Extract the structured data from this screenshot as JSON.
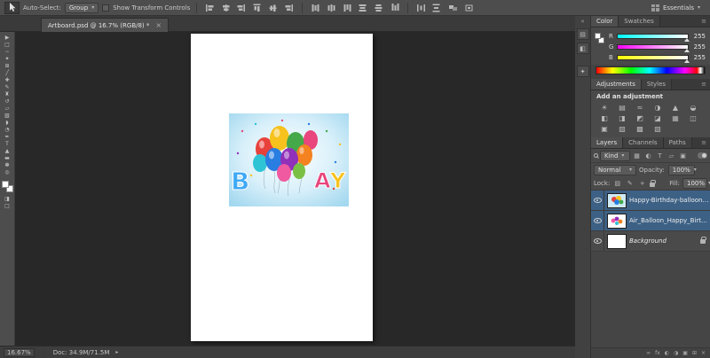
{
  "colors": {
    "selection_highlight": "#3d6185",
    "canvas_background": "#282828",
    "artboard_white": "#ffffff"
  },
  "options_bar": {
    "auto_select_label": "Auto-Select:",
    "auto_select_value": "Group",
    "show_transform_label": "Show Transform Controls",
    "workspace_label": "Essentials"
  },
  "document_tab": {
    "title": "Artboard.psd @ 16.7% (RGB/8) *",
    "close_glyph": "×"
  },
  "toolbar": {
    "tools": [
      {
        "name": "move-tool",
        "glyph": "▶"
      },
      {
        "name": "rectangular-marquee-tool",
        "glyph": "□"
      },
      {
        "name": "lasso-tool",
        "glyph": "∽"
      },
      {
        "name": "quick-selection-tool",
        "glyph": "✦"
      },
      {
        "name": "crop-tool",
        "glyph": "⊞"
      },
      {
        "name": "eyedropper-tool",
        "glyph": "╱"
      },
      {
        "name": "spot-healing-brush-tool",
        "glyph": "✚"
      },
      {
        "name": "brush-tool",
        "glyph": "✎"
      },
      {
        "name": "clone-stamp-tool",
        "glyph": "♜"
      },
      {
        "name": "history-brush-tool",
        "glyph": "↺"
      },
      {
        "name": "eraser-tool",
        "glyph": "▱"
      },
      {
        "name": "gradient-tool",
        "glyph": "▧"
      },
      {
        "name": "blur-tool",
        "glyph": "◗"
      },
      {
        "name": "dodge-tool",
        "glyph": "◔"
      },
      {
        "name": "pen-tool",
        "glyph": "✒"
      },
      {
        "name": "horizontal-type-tool",
        "glyph": "T"
      },
      {
        "name": "path-selection-tool",
        "glyph": "▲"
      },
      {
        "name": "rectangle-tool",
        "glyph": "▬"
      },
      {
        "name": "hand-tool",
        "glyph": "✽"
      },
      {
        "name": "zoom-tool",
        "glyph": "◎"
      }
    ],
    "extras": [
      {
        "name": "quick-mask-button",
        "glyph": "◨"
      },
      {
        "name": "screen-mode-button",
        "glyph": "□"
      }
    ]
  },
  "color_panel": {
    "tabs": [
      "Color",
      "Swatches"
    ],
    "menu_glyph": "≡",
    "channels": [
      {
        "label": "R",
        "value": "255",
        "track_from": "#00ffff",
        "track_to": "#ffffff"
      },
      {
        "label": "G",
        "value": "255",
        "track_from": "#ff00ff",
        "track_to": "#ffffff"
      },
      {
        "label": "B",
        "value": "255",
        "track_from": "#ffff00",
        "track_to": "#ffffff"
      }
    ]
  },
  "adjustments_panel": {
    "tabs": [
      "Adjustments",
      "Styles"
    ],
    "title": "Add an adjustment",
    "icons": [
      {
        "name": "brightness-contrast-icon",
        "glyph": "☀"
      },
      {
        "name": "levels-icon",
        "glyph": "▤"
      },
      {
        "name": "curves-icon",
        "glyph": "≈"
      },
      {
        "name": "exposure-icon",
        "glyph": "◑"
      },
      {
        "name": "vibrance-icon",
        "glyph": "▲"
      },
      {
        "name": "hue-saturation-icon",
        "glyph": "◒"
      },
      {
        "name": "color-balance-icon",
        "glyph": "◧"
      },
      {
        "name": "black-white-icon",
        "glyph": "◨"
      },
      {
        "name": "photo-filter-icon",
        "glyph": "◩"
      },
      {
        "name": "channel-mixer-icon",
        "glyph": "◪"
      },
      {
        "name": "color-lookup-icon",
        "glyph": "▦"
      },
      {
        "name": "invert-icon",
        "glyph": "◫"
      },
      {
        "name": "posterize-icon",
        "glyph": "▣"
      },
      {
        "name": "threshold-icon",
        "glyph": "▨"
      },
      {
        "name": "selective-color-icon",
        "glyph": "▩"
      },
      {
        "name": "gradient-map-icon",
        "glyph": "▧"
      }
    ]
  },
  "layers_panel": {
    "tabs": [
      "Layers",
      "Channels",
      "Paths"
    ],
    "kind_value": "Kind",
    "filter_icons": [
      {
        "name": "pixel-layer-filter-icon",
        "glyph": "▦"
      },
      {
        "name": "adjustment-layer-filter-icon",
        "glyph": "◐"
      },
      {
        "name": "type-layer-filter-icon",
        "glyph": "T"
      },
      {
        "name": "shape-layer-filter-icon",
        "glyph": "▱"
      },
      {
        "name": "smart-object-filter-icon",
        "glyph": "▣"
      }
    ],
    "blend_mode": "Normal",
    "opacity_label": "Opacity:",
    "opacity_value": "100%",
    "lock_label": "Lock:",
    "lock_icons": [
      {
        "name": "lock-transparent-pixels-icon",
        "glyph": "▨"
      },
      {
        "name": "lock-image-pixels-icon",
        "glyph": "✎"
      },
      {
        "name": "lock-position-icon",
        "glyph": "+"
      }
    ],
    "fill_label": "Fill:",
    "fill_value": "100%",
    "layers": [
      {
        "name": "Happy-Birthday-balloons-...",
        "selected": true
      },
      {
        "name": "Air_Balloon_Happy_Birth...",
        "selected": true
      },
      {
        "name": "Background",
        "selected": false,
        "locked": true
      }
    ],
    "footer_icons": [
      {
        "name": "link-layers-icon",
        "glyph": "∞"
      },
      {
        "name": "layer-effects-icon",
        "glyph": "fx"
      },
      {
        "name": "layer-mask-icon",
        "glyph": "◐"
      },
      {
        "name": "new-adjustment-layer-icon",
        "glyph": "◑"
      },
      {
        "name": "layer-group-icon",
        "glyph": "▣"
      },
      {
        "name": "new-layer-icon",
        "glyph": "⊞"
      },
      {
        "name": "delete-layer-icon",
        "glyph": "×"
      }
    ]
  },
  "dock_strip": {
    "collapse_glyph": "«",
    "icons": [
      {
        "name": "history-panel-icon",
        "glyph": "▤"
      },
      {
        "name": "properties-panel-icon",
        "glyph": "◧"
      },
      {
        "name": "info-panel-icon",
        "glyph": "✦"
      }
    ]
  },
  "status_bar": {
    "zoom": "16.67%",
    "doc_info": "Doc: 34.9M/71.5M",
    "popup_glyph": "▸"
  },
  "artwork": {
    "letter_left": "B",
    "letter_a": "A",
    "letter_y": "Y"
  }
}
